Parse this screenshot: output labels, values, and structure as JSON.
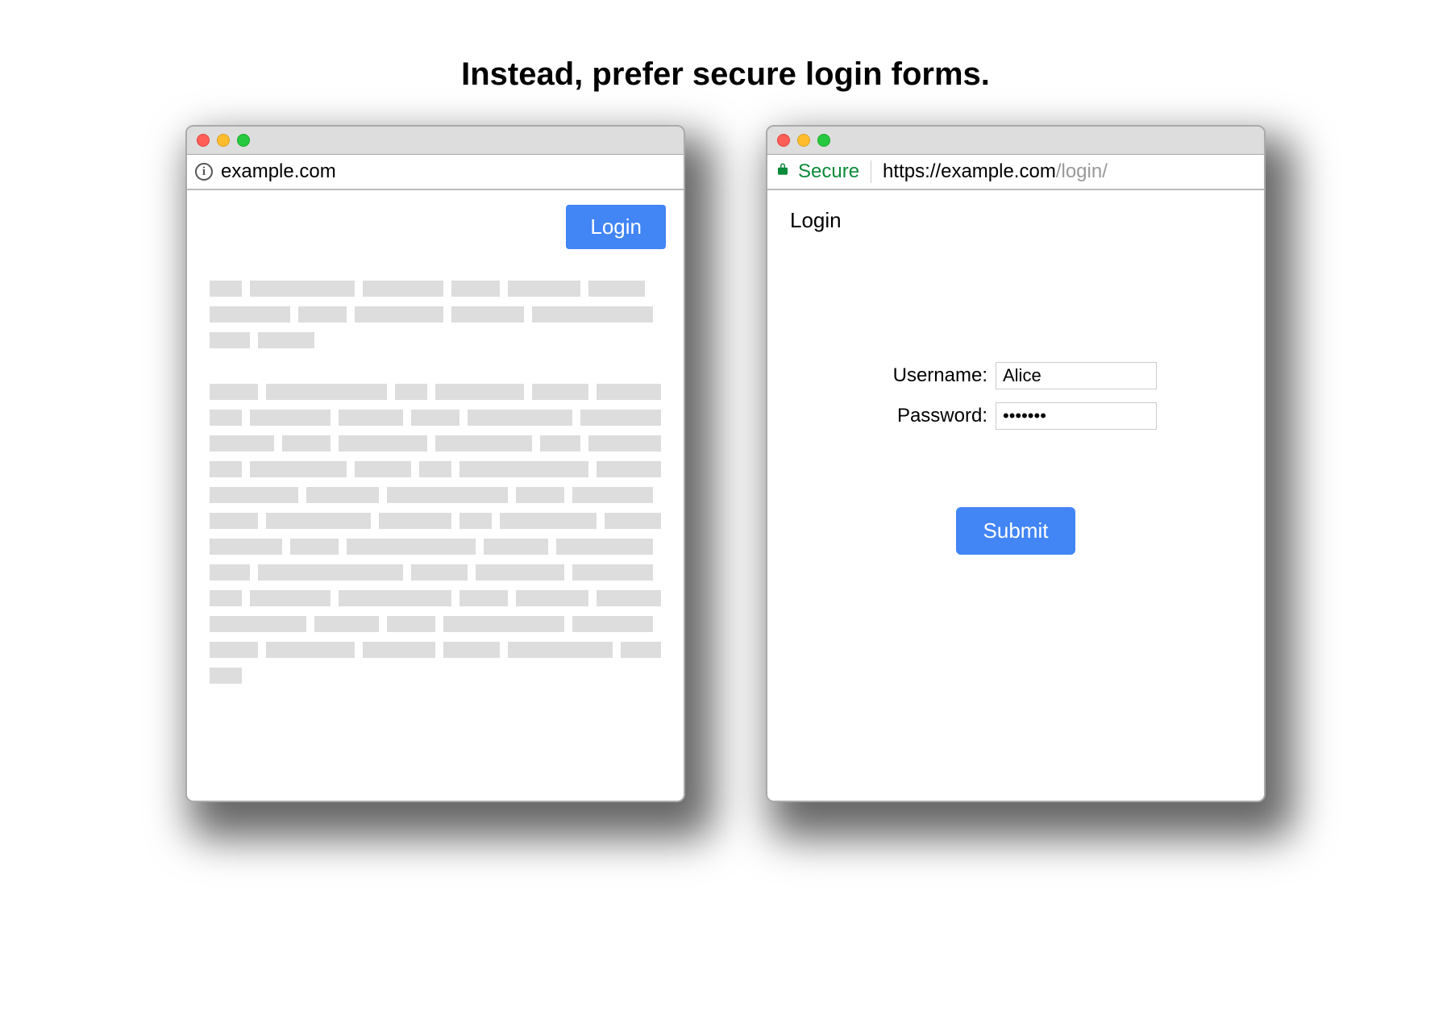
{
  "heading": "Instead, prefer secure login forms.",
  "left": {
    "url": "example.com",
    "login_button": "Login"
  },
  "right": {
    "secure_label": "Secure",
    "url_proto": "https://",
    "url_host": "example.com",
    "url_path": "/login/",
    "login_title": "Login",
    "username_label": "Username:",
    "username_value": "Alice",
    "password_label": "Password:",
    "password_value": "•••••••",
    "submit_label": "Submit"
  }
}
